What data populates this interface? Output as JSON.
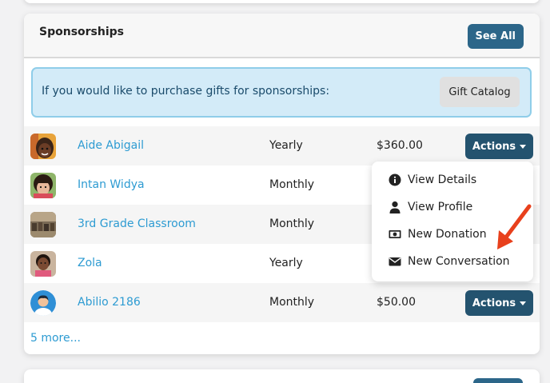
{
  "card": {
    "title": "Sponsorships",
    "see_all_label": "See All"
  },
  "alert": {
    "text": "If you would like to purchase gifts for sponsorships:",
    "gift_button_label": "Gift Catalog"
  },
  "rows": [
    {
      "name": "Aide Abigail",
      "frequency": "Yearly",
      "amount": "$360.00",
      "actions_label": "Actions",
      "avatar": "child-photo-1"
    },
    {
      "name": "Intan Widya",
      "frequency": "Monthly",
      "amount": "",
      "actions_label": "",
      "avatar": "child-photo-2"
    },
    {
      "name": "3rd Grade Classroom",
      "frequency": "Monthly",
      "amount": "",
      "actions_label": "",
      "avatar": "classroom-photo"
    },
    {
      "name": "Zola",
      "frequency": "Yearly",
      "amount": "",
      "actions_label": "",
      "avatar": "child-photo-3"
    },
    {
      "name": "Abilio 2186",
      "frequency": "Monthly",
      "amount": "$50.00",
      "actions_label": "Actions",
      "avatar": "default-avatar"
    }
  ],
  "more_link": "5 more...",
  "dropdown": {
    "items": [
      {
        "label": "View Details",
        "icon": "info-circle-icon"
      },
      {
        "label": "View Profile",
        "icon": "user-icon"
      },
      {
        "label": "New Donation",
        "icon": "money-bill-icon"
      },
      {
        "label": "New Conversation",
        "icon": "envelope-icon"
      }
    ]
  },
  "colors": {
    "primary_button": "#2c6689",
    "actions_button": "#24536f",
    "link": "#2d9bd2",
    "alert_bg": "#d3ebf8",
    "annotation_arrow": "#e8401c"
  }
}
